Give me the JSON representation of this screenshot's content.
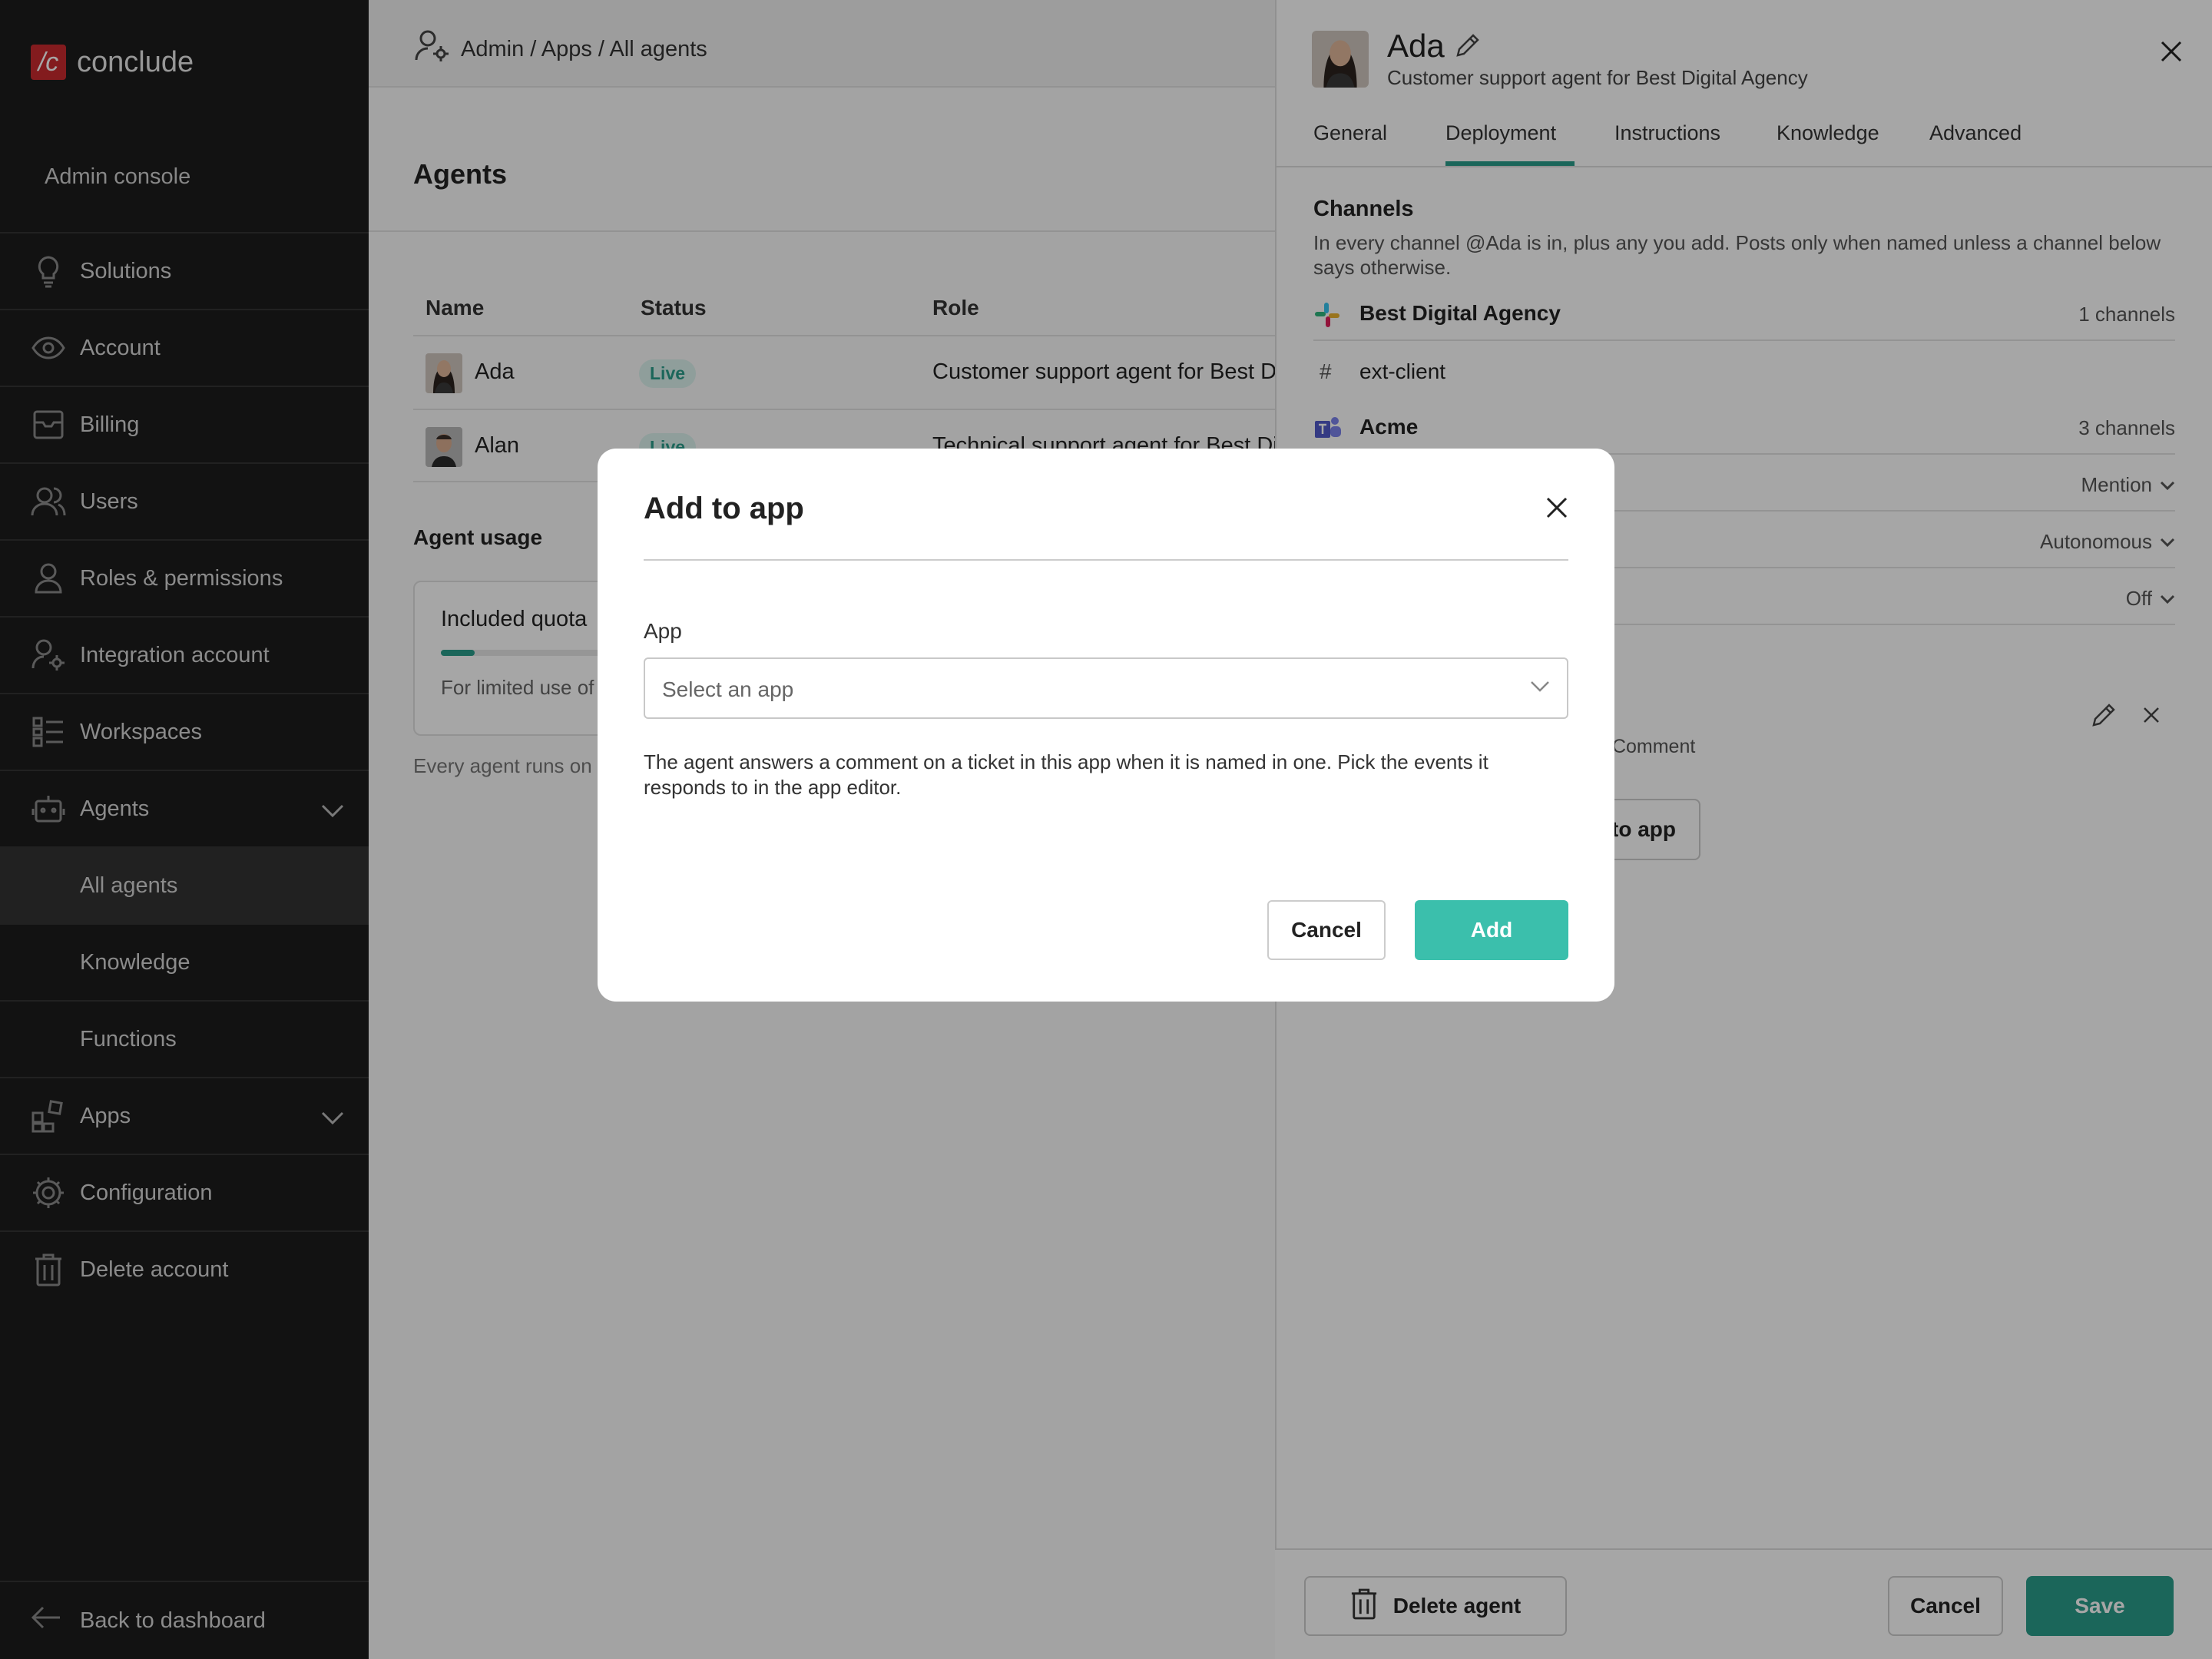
{
  "sidebar": {
    "logo_mark": "/c",
    "logo_text": "conclude",
    "console_label": "Admin console",
    "items": [
      {
        "label": "Solutions",
        "icon": "lightbulb-icon"
      },
      {
        "label": "Account",
        "icon": "eye-icon"
      },
      {
        "label": "Billing",
        "icon": "billing-icon"
      },
      {
        "label": "Users",
        "icon": "users-icon"
      },
      {
        "label": "Roles & permissions",
        "icon": "person-icon"
      },
      {
        "label": "Integration account",
        "icon": "person-gear-icon"
      },
      {
        "label": "Workspaces",
        "icon": "list-icon"
      },
      {
        "label": "Agents",
        "icon": "robot-icon"
      },
      {
        "label": "All agents"
      },
      {
        "label": "Knowledge"
      },
      {
        "label": "Functions"
      },
      {
        "label": "Apps",
        "icon": "apps-icon"
      },
      {
        "label": "Configuration",
        "icon": "gear-icon"
      },
      {
        "label": "Delete account",
        "icon": "trash-icon"
      }
    ],
    "back_label": "Back to dashboard"
  },
  "main": {
    "breadcrumb": "Admin / Apps / All agents",
    "title": "Agents",
    "columns": [
      "Name",
      "Status",
      "Role"
    ],
    "rows": [
      {
        "name": "Ada",
        "status": "Live",
        "role": "Customer support agent for Best Digital Agency"
      },
      {
        "name": "Alan",
        "status": "Live",
        "role": "Technical support agent for Best Digital Agency"
      }
    ],
    "usage_title": "Agent usage",
    "quota_label": "Included quota",
    "quota_desc": "For limited use of agents",
    "usage_note": "Every agent runs on the included quota"
  },
  "panel": {
    "name": "Ada",
    "subtitle": "Customer support agent for Best Digital Agency",
    "tabs": [
      "General",
      "Deployment",
      "Instructions",
      "Knowledge",
      "Advanced"
    ],
    "active_tab": "Deployment",
    "channels_title": "Channels",
    "channels_desc": "In every channel @Ada is in, plus any you add. Posts only when named unless a channel below says otherwise.",
    "workspaces": [
      {
        "name": "Best Digital Agency",
        "count": "1 channels",
        "icon": "slack-icon"
      },
      {
        "name": "ext-client",
        "icon": "hash-icon"
      },
      {
        "name": "Acme",
        "count": "3 channels",
        "icon": "teams-icon"
      }
    ],
    "settings": [
      "Mention",
      "Autonomous",
      "Off"
    ],
    "app_detail": "onds to Comment",
    "add_app_label": "to app",
    "delete_label": "Delete agent",
    "cancel_label": "Cancel",
    "save_label": "Save"
  },
  "modal": {
    "title": "Add to app",
    "field_label": "App",
    "select_placeholder": "Select an app",
    "help": "The agent answers a comment on a ticket in this app when it is named in one. Pick the events it responds to in the app editor.",
    "cancel_label": "Cancel",
    "add_label": "Add"
  },
  "colors": {
    "accent": "#2a9d8a",
    "add_button": "#3bbfac",
    "brand": "#c92a2f",
    "sidebar": "#1c1c1c"
  }
}
